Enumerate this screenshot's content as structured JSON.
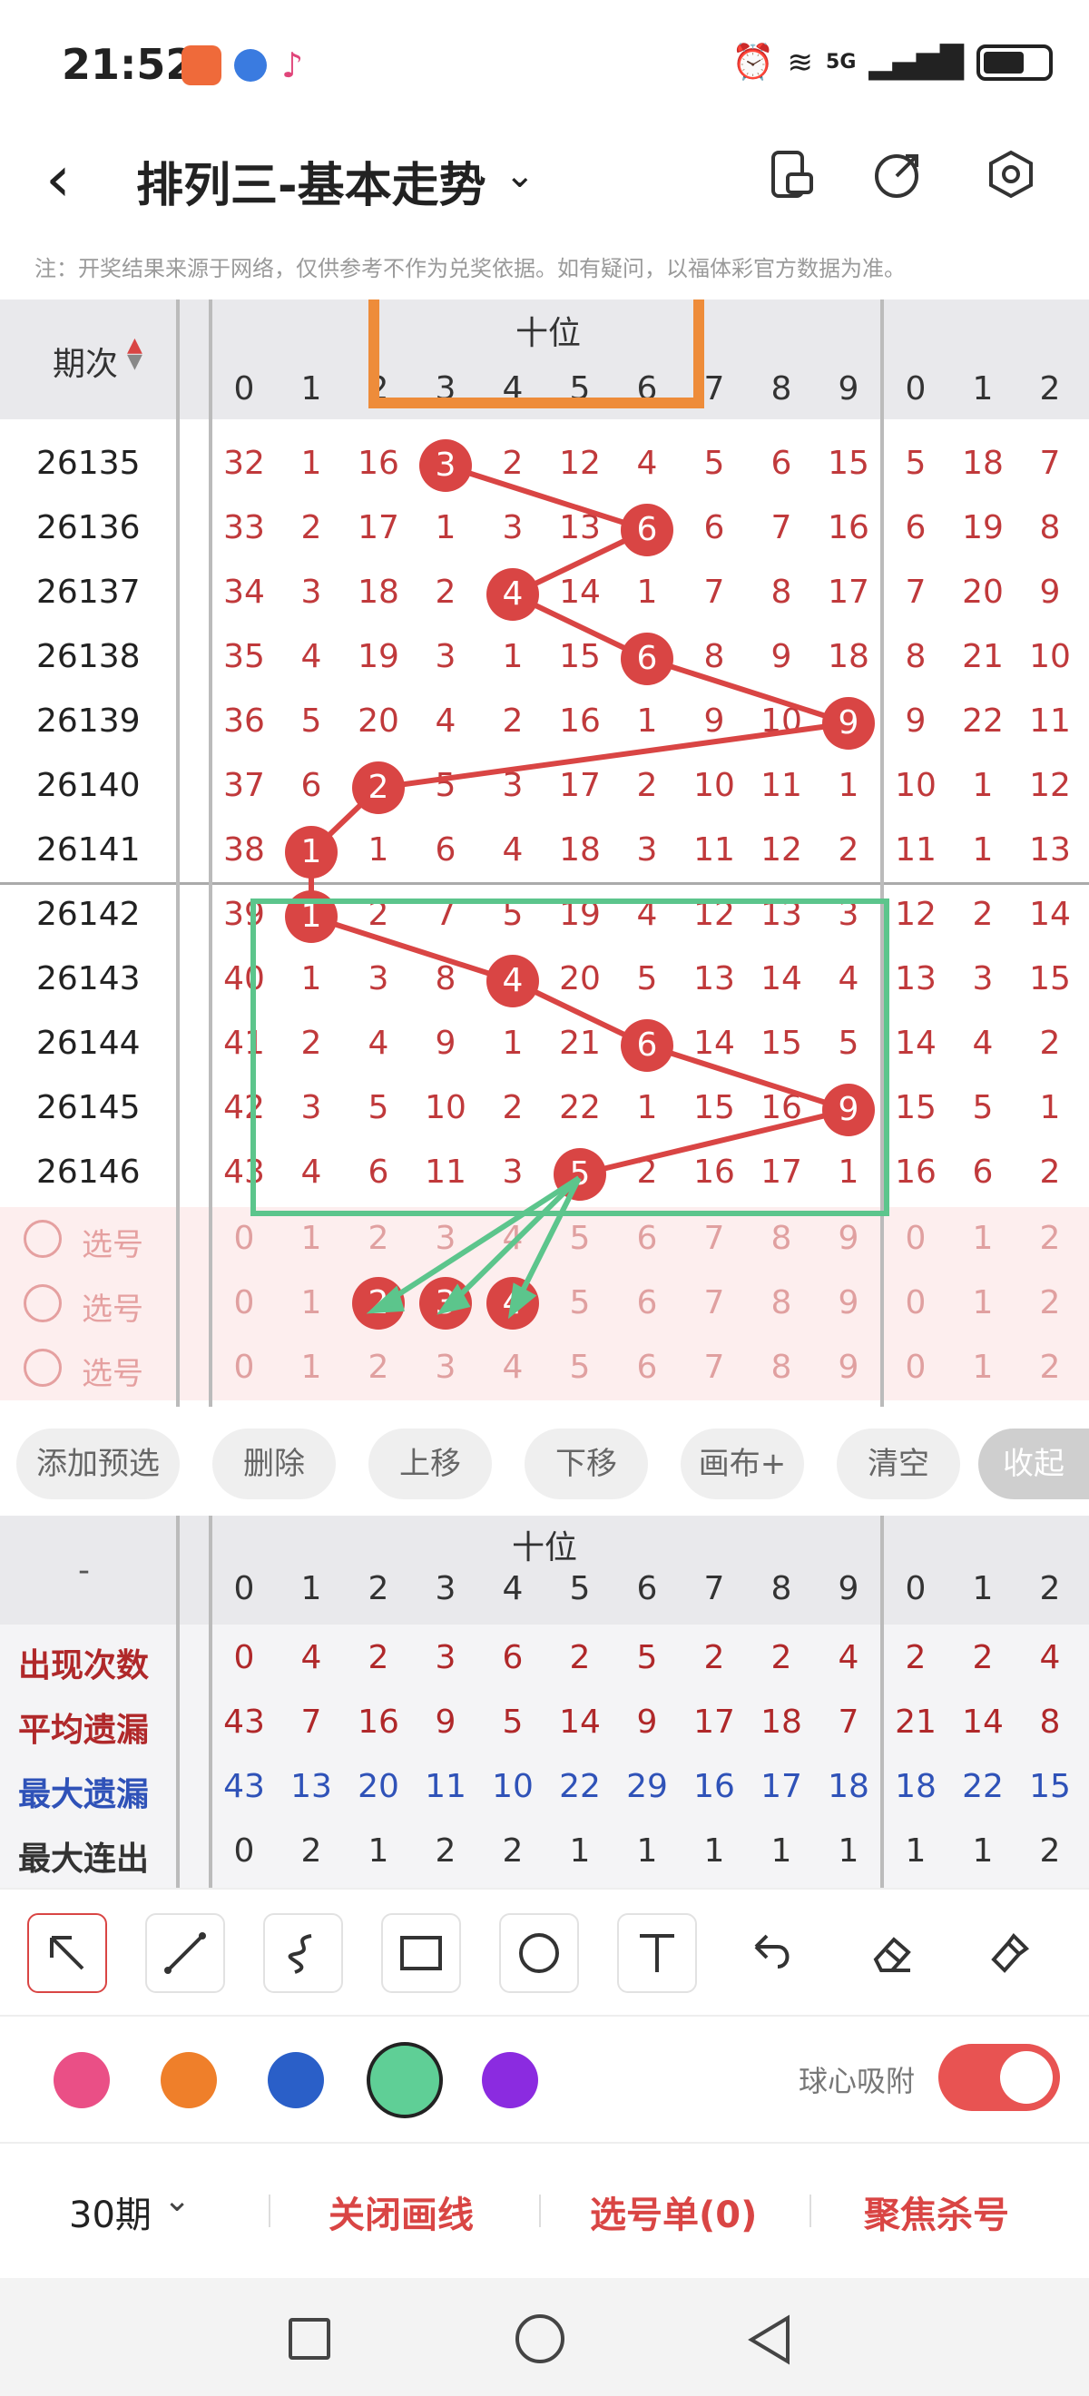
{
  "status": {
    "time": "21:52",
    "network": "5G"
  },
  "header": {
    "title": "排列三-基本走势"
  },
  "notice": "注：开奖结果来源于网络，仅供参考不作为兑奖依据。如有疑问，以福体彩官方数据为准。",
  "grid": {
    "period_header": "期次",
    "group_header": "十位",
    "digits": [
      "0",
      "1",
      "2",
      "3",
      "4",
      "5",
      "6",
      "7",
      "8",
      "9"
    ],
    "right_digits": [
      "0",
      "1",
      "2"
    ],
    "rows": [
      {
        "period": "26135",
        "cells": [
          "32",
          "1",
          "16",
          "3",
          "2",
          "12",
          "4",
          "5",
          "6",
          "15"
        ],
        "hit": 3,
        "right": [
          "5",
          "18",
          "7"
        ]
      },
      {
        "period": "26136",
        "cells": [
          "33",
          "2",
          "17",
          "1",
          "3",
          "13",
          "6",
          "6",
          "7",
          "16"
        ],
        "hit": 6,
        "right": [
          "6",
          "19",
          "8"
        ]
      },
      {
        "period": "26137",
        "cells": [
          "34",
          "3",
          "18",
          "2",
          "4",
          "14",
          "1",
          "7",
          "8",
          "17"
        ],
        "hit": 4,
        "right": [
          "7",
          "20",
          "9"
        ]
      },
      {
        "period": "26138",
        "cells": [
          "35",
          "4",
          "19",
          "3",
          "1",
          "15",
          "6",
          "8",
          "9",
          "18"
        ],
        "hit": 6,
        "right": [
          "8",
          "21",
          "10"
        ]
      },
      {
        "period": "26139",
        "cells": [
          "36",
          "5",
          "20",
          "4",
          "2",
          "16",
          "1",
          "9",
          "10",
          "9"
        ],
        "hit": 9,
        "right": [
          "9",
          "22",
          "11"
        ]
      },
      {
        "period": "26140",
        "cells": [
          "37",
          "6",
          "2",
          "5",
          "3",
          "17",
          "2",
          "10",
          "11",
          "1"
        ],
        "hit": 2,
        "right": [
          "10",
          "1",
          "12"
        ]
      },
      {
        "period": "26141",
        "cells": [
          "38",
          "1",
          "1",
          "6",
          "4",
          "18",
          "3",
          "11",
          "12",
          "2"
        ],
        "hit": 1,
        "right": [
          "11",
          "1",
          "13"
        ]
      },
      {
        "period": "26142",
        "cells": [
          "39",
          "1",
          "2",
          "7",
          "5",
          "19",
          "4",
          "12",
          "13",
          "3"
        ],
        "hit": 1,
        "right": [
          "12",
          "2",
          "14"
        ]
      },
      {
        "period": "26143",
        "cells": [
          "40",
          "1",
          "3",
          "8",
          "4",
          "20",
          "5",
          "13",
          "14",
          "4"
        ],
        "hit": 4,
        "right": [
          "13",
          "3",
          "15"
        ]
      },
      {
        "period": "26144",
        "cells": [
          "41",
          "2",
          "4",
          "9",
          "1",
          "21",
          "6",
          "14",
          "15",
          "5"
        ],
        "hit": 6,
        "right": [
          "14",
          "4",
          "2"
        ]
      },
      {
        "period": "26145",
        "cells": [
          "42",
          "3",
          "5",
          "10",
          "2",
          "22",
          "1",
          "15",
          "16",
          "9"
        ],
        "hit": 9,
        "right": [
          "15",
          "5",
          "1"
        ]
      },
      {
        "period": "26146",
        "cells": [
          "43",
          "4",
          "6",
          "11",
          "3",
          "5",
          "2",
          "16",
          "17",
          "1"
        ],
        "hit": 5,
        "right": [
          "16",
          "6",
          "2"
        ]
      }
    ],
    "select_label": "选号",
    "select_rows": [
      {
        "cells": [
          "0",
          "1",
          "2",
          "3",
          "4",
          "5",
          "6",
          "7",
          "8",
          "9"
        ],
        "right": [
          "0",
          "1",
          "2"
        ],
        "picked": []
      },
      {
        "cells": [
          "0",
          "1",
          "2",
          "3",
          "4",
          "5",
          "6",
          "7",
          "8",
          "9"
        ],
        "right": [
          "0",
          "1",
          "2"
        ],
        "picked": [
          2,
          3,
          4
        ]
      },
      {
        "cells": [
          "0",
          "1",
          "2",
          "3",
          "4",
          "5",
          "6",
          "7",
          "8",
          "9"
        ],
        "right": [
          "0",
          "1",
          "2"
        ],
        "picked": []
      }
    ]
  },
  "buttons": {
    "add": "添加预选",
    "delete": "删除",
    "up": "上移",
    "down": "下移",
    "canvas": "画布+",
    "clear": "清空",
    "collapse": "收起"
  },
  "stats": {
    "corner": "-",
    "group_header": "十位",
    "rows": [
      {
        "label": "出现次数",
        "color": "#b0282a",
        "values": [
          "0",
          "4",
          "2",
          "3",
          "6",
          "2",
          "5",
          "2",
          "2",
          "4"
        ],
        "right": [
          "2",
          "2",
          "4"
        ]
      },
      {
        "label": "平均遗漏",
        "color": "#b0282a",
        "values": [
          "43",
          "7",
          "16",
          "9",
          "5",
          "14",
          "9",
          "17",
          "18",
          "7"
        ],
        "right": [
          "21",
          "14",
          "8"
        ]
      },
      {
        "label": "最大遗漏",
        "color": "#2f52b8",
        "values": [
          "43",
          "13",
          "20",
          "11",
          "10",
          "22",
          "29",
          "16",
          "17",
          "18"
        ],
        "right": [
          "18",
          "22",
          "15"
        ]
      },
      {
        "label": "最大连出",
        "color": "#333333",
        "values": [
          "0",
          "2",
          "1",
          "2",
          "2",
          "1",
          "1",
          "1",
          "1",
          "1"
        ],
        "right": [
          "1",
          "1",
          "2"
        ]
      }
    ]
  },
  "tools": [
    "arrow-tool-icon",
    "line-tool-icon",
    "curve-tool-icon",
    "rect-tool-icon",
    "circle-tool-icon",
    "text-tool-icon",
    "undo-icon",
    "eraser-icon",
    "clear-brush-icon"
  ],
  "colors": [
    "#ea4f86",
    "#ef7f2a",
    "#2a5fc8",
    "#5fcf96",
    "#8b2be0"
  ],
  "snap_label": "球心吸附",
  "actions": {
    "periods": "30期",
    "close_draw": "关闭画线",
    "selection": "选号单(0)",
    "focus": "聚焦杀号"
  }
}
